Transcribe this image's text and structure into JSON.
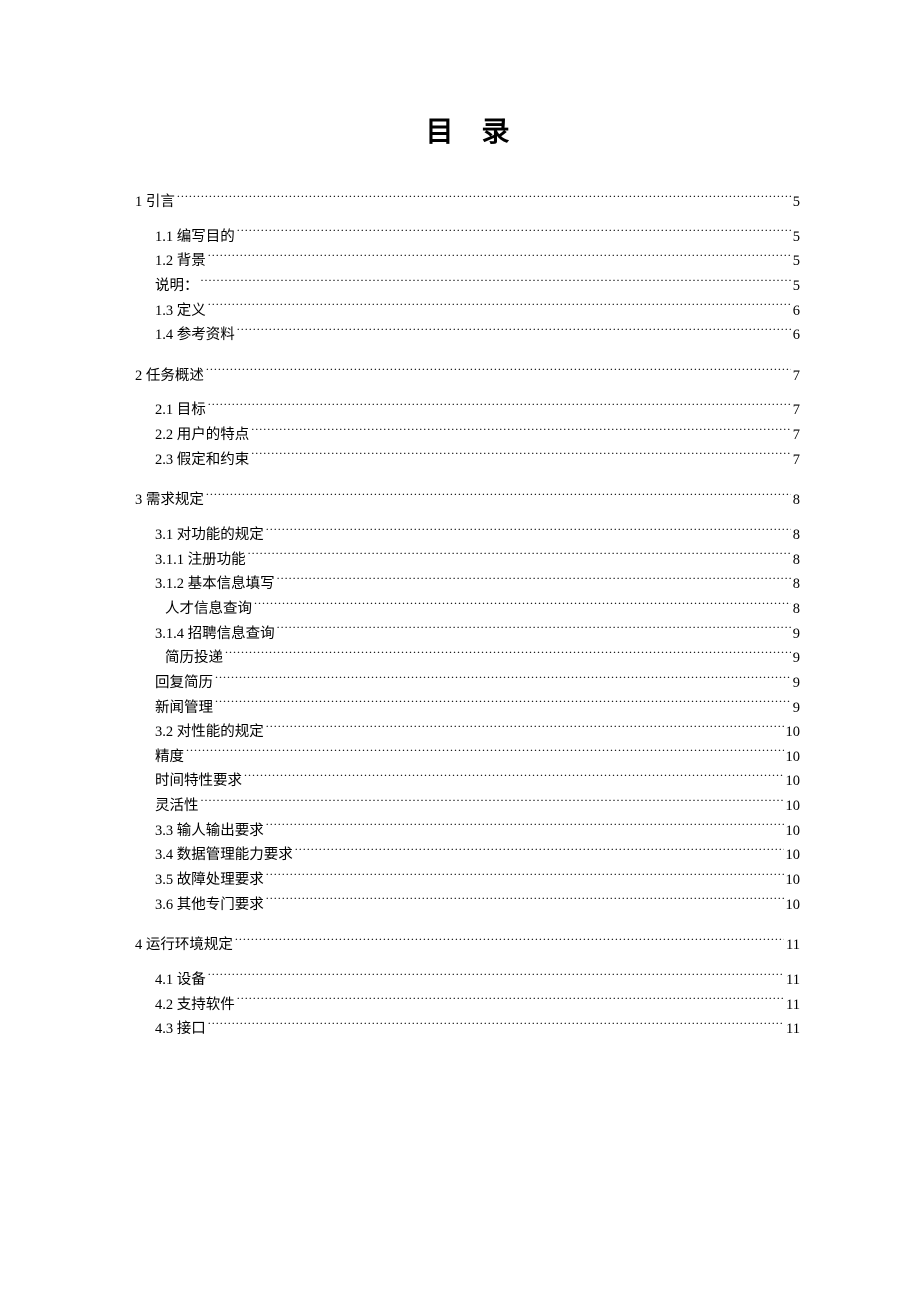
{
  "title": "目录",
  "entries": [
    {
      "level": 1,
      "label": "1 引言",
      "page": "5"
    },
    {
      "level": 2,
      "label": "1.1 编写目的",
      "page": "5"
    },
    {
      "level": 2,
      "label": "1.2 背景",
      "page": "5"
    },
    {
      "level": 2,
      "label": "说明：",
      "page": "5"
    },
    {
      "level": 2,
      "label": "1.3 定义",
      "page": "6"
    },
    {
      "level": 2,
      "label": "1.4 参考资料",
      "page": "6"
    },
    {
      "level": 1,
      "label": "2 任务概述",
      "page": "7"
    },
    {
      "level": 2,
      "label": "2.1 目标",
      "page": "7"
    },
    {
      "level": 2,
      "label": "2.2 用户的特点",
      "page": "7"
    },
    {
      "level": 2,
      "label": "2.3 假定和约束",
      "page": "7"
    },
    {
      "level": 1,
      "label": "3 需求规定",
      "page": "8"
    },
    {
      "level": 2,
      "label": "3.1 对功能的规定",
      "page": "8"
    },
    {
      "level": 3,
      "label": "3.1.1  注册功能",
      "page": "8"
    },
    {
      "level": 3,
      "label": "3.1.2  基本信息填写",
      "page": "8"
    },
    {
      "level": "3b",
      "label": "人才信息查询",
      "page": "8"
    },
    {
      "level": 3,
      "label": "3.1.4  招聘信息查询",
      "page": "9"
    },
    {
      "level": "3b",
      "label": "简历投递",
      "page": "9"
    },
    {
      "level": 2,
      "label": "回复简历",
      "page": "9"
    },
    {
      "level": 2,
      "label": "新闻管理",
      "page": "9"
    },
    {
      "level": 2,
      "label": "3.2 对性能的规定",
      "page": "10"
    },
    {
      "level": 2,
      "label": "精度",
      "page": "10"
    },
    {
      "level": 2,
      "label": "时间特性要求",
      "page": "10"
    },
    {
      "level": 2,
      "label": "灵活性",
      "page": "10"
    },
    {
      "level": 2,
      "label": "3.3 输人输出要求",
      "page": "10"
    },
    {
      "level": 2,
      "label": "3.4 数据管理能力要求",
      "page": "10"
    },
    {
      "level": 2,
      "label": "3.5 故障处理要求",
      "page": "10"
    },
    {
      "level": 2,
      "label": "3.6 其他专门要求",
      "page": "10"
    },
    {
      "level": 1,
      "label": "4 运行环境规定",
      "page": "11"
    },
    {
      "level": 2,
      "label": "4.1 设备",
      "page": "11"
    },
    {
      "level": 2,
      "label": "4.2 支持软件",
      "page": "11"
    },
    {
      "level": 2,
      "label": "4.3 接口",
      "page": "11"
    }
  ]
}
